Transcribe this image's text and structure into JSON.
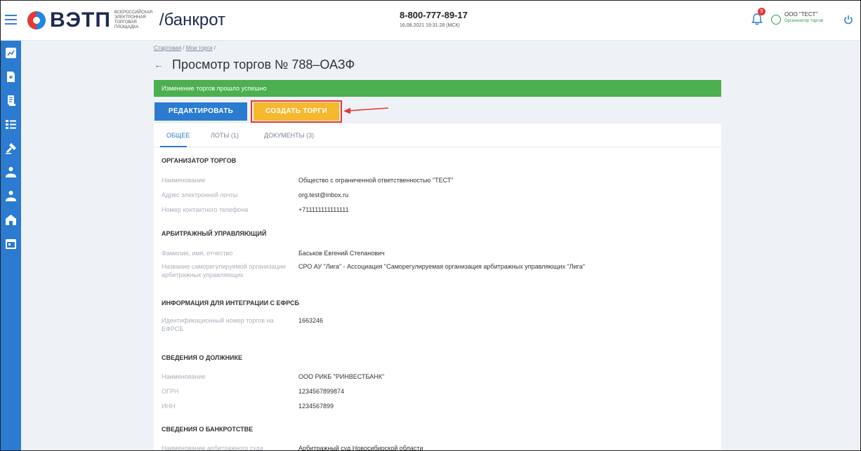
{
  "header": {
    "logo_word": "ВЭТП",
    "logo_sub": "Всероссийская электронная торговая площадка",
    "logo_suffix": "/банкрот",
    "phone": "8-800-777-89-17",
    "datetime": "16.08.2021 19:31:28 (МСК)",
    "notifications_count": "9",
    "user_name": "ООО \"ТЕСТ\"",
    "user_role": "Организатор торгов"
  },
  "breadcrumb": {
    "home": "Стартовая",
    "sep1": "/",
    "my_trades": "Мои торги",
    "sep2": "/"
  },
  "page_title": "Просмотр торгов № 788–ОАЗФ",
  "banner_text": "Изменение торгов прошло успешно",
  "buttons": {
    "edit": "РЕДАКТИРОВАТЬ",
    "create": "СОЗДАТЬ ТОРГИ"
  },
  "tabs": [
    {
      "label": "ОБЩЕЕ"
    },
    {
      "label": "ЛОТЫ (1)"
    },
    {
      "label": "ДОКУМЕНТЫ (3)"
    }
  ],
  "sections": {
    "organizer": {
      "title": "ОРГАНИЗАТОР ТОРГОВ",
      "rows": [
        {
          "label": "Наименование",
          "value": "Общество с ограниченной ответственностью \"ТЕСТ\""
        },
        {
          "label": "Адрес электронной почты",
          "value": "org.test@inbox.ru"
        },
        {
          "label": "Номер контактного телефона",
          "value": "+711111111111111"
        }
      ]
    },
    "manager": {
      "title": "АРБИТРАЖНЫЙ УПРАВЛЯЮЩИЙ",
      "rows": [
        {
          "label": "Фамилия, имя, отчество",
          "value": "Баськов Евгений Степанович"
        },
        {
          "label": "Название саморегулируемой организации арбитражных управляющих",
          "value": "СРО АУ \"Лига\" - Ассоциация \"Саморегулируемая организация арбитражных управляющих \"Лига\""
        }
      ]
    },
    "integration": {
      "title": "ИНФОРМАЦИЯ ДЛЯ ИНТЕГРАЦИИ С ЕФРСБ",
      "rows": [
        {
          "label": "Идентификационный номер торгов на ЕФРСБ",
          "value": "1663246"
        }
      ]
    },
    "debtor": {
      "title": "СВЕДЕНИЯ О ДОЛЖНИКЕ",
      "rows": [
        {
          "label": "Наименование",
          "value": "ООО РИКБ \"РИНВЕСТБАНК\""
        },
        {
          "label": "ОГРН",
          "value": "1234567899874"
        },
        {
          "label": "ИНН",
          "value": "1234567899"
        }
      ]
    },
    "bankruptcy": {
      "title": "СВЕДЕНИЯ О БАНКРОТСТВЕ",
      "rows": [
        {
          "label": "Наименование арбитражного суда",
          "value": "Арбитражный суд Новосибирской области"
        }
      ]
    }
  },
  "colors": {
    "primary": "#2b7bd0",
    "success": "#4caf50",
    "create_button": "#f5b82e",
    "highlight": "#e53935"
  },
  "sidebar_icons": [
    "dashboard-icon",
    "document-add-icon",
    "scroll-icon",
    "list-icon",
    "gavel-icon",
    "user-check-icon",
    "user-search-icon",
    "home-icon",
    "calendar-icon"
  ]
}
